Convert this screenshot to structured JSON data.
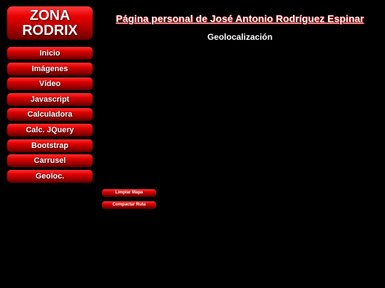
{
  "logo": {
    "line1": "ZONA",
    "line2": "RODRIX"
  },
  "nav": {
    "items": [
      {
        "label": "Inicio"
      },
      {
        "label": "Imágenes"
      },
      {
        "label": "Vídeo"
      },
      {
        "label": "Javascript"
      },
      {
        "label": "Calculadora"
      },
      {
        "label": "Calc. JQuery"
      },
      {
        "label": "Bootstrap"
      },
      {
        "label": "Carrusel"
      },
      {
        "label": "Geoloc."
      }
    ]
  },
  "header": {
    "title": "Página personal de José Antonio Rodríguez Espinar",
    "section": "Geolocalización"
  },
  "controls": {
    "clear_map": "Limpiar Mapa",
    "compact_route": "Compactar Ruta"
  },
  "colors": {
    "background": "#000000",
    "accent": "#e00000",
    "text": "#ffffff"
  }
}
